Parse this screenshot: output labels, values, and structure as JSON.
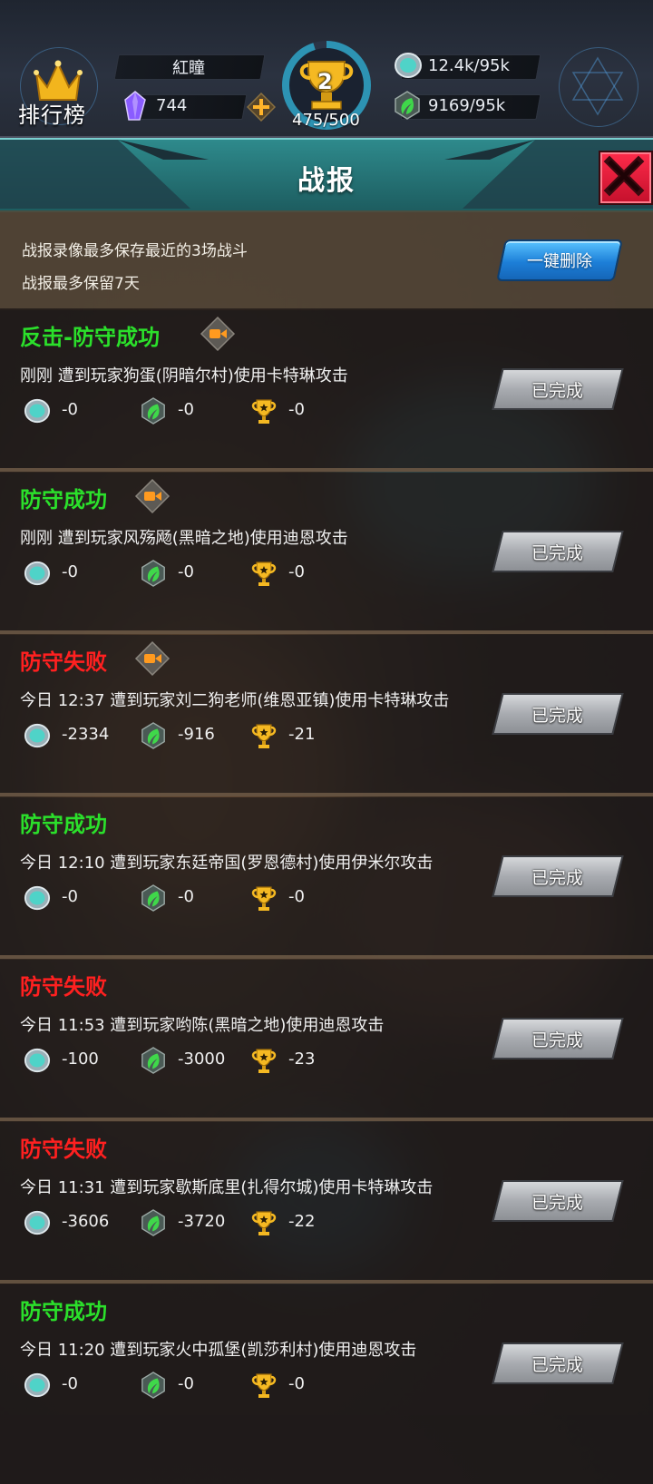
{
  "header": {
    "rank_label": "排行榜",
    "player_name": "紅瞳",
    "gems": "744",
    "trophy_level": "2",
    "trophy_progress": "475/500",
    "trophy_progress_fraction": 0.95,
    "stone": "12.4k/95k",
    "leaf": "9169/95k"
  },
  "title": "战报",
  "info": {
    "line1": "战报录像最多保存最近的3场战斗",
    "line2": "战报最多保留7天",
    "delete_all": "一键删除"
  },
  "reports": [
    {
      "result": "反击-防守成功",
      "status": "win",
      "video": true,
      "desc": "刚刚 遭到玩家狗蛋(阴暗尔村)使用卡特琳攻击",
      "stone": "-0",
      "leaf": "-0",
      "trophy": "-0",
      "button": "已完成"
    },
    {
      "result": "防守成功",
      "status": "win",
      "video": true,
      "desc": "刚刚 遭到玩家风殇飏(黑暗之地)使用迪恩攻击",
      "stone": "-0",
      "leaf": "-0",
      "trophy": "-0",
      "button": "已完成"
    },
    {
      "result": "防守失败",
      "status": "lose",
      "video": true,
      "desc": "今日 12:37 遭到玩家刘二狗老师(维恩亚镇)使用卡特琳攻击",
      "stone": "-2334",
      "leaf": "-916",
      "trophy": "-21",
      "button": "已完成"
    },
    {
      "result": "防守成功",
      "status": "win",
      "video": false,
      "desc": "今日 12:10 遭到玩家东廷帝国(罗恩德村)使用伊米尔攻击",
      "stone": "-0",
      "leaf": "-0",
      "trophy": "-0",
      "button": "已完成"
    },
    {
      "result": "防守失败",
      "status": "lose",
      "video": false,
      "desc": "今日 11:53 遭到玩家哟陈(黑暗之地)使用迪恩攻击",
      "stone": "-100",
      "leaf": "-3000",
      "trophy": "-23",
      "button": "已完成"
    },
    {
      "result": "防守失败",
      "status": "lose",
      "video": false,
      "desc": "今日 11:31 遭到玩家歇斯底里(扎得尔城)使用卡特琳攻击",
      "stone": "-3606",
      "leaf": "-3720",
      "trophy": "-22",
      "button": "已完成"
    },
    {
      "result": "防守成功",
      "status": "win",
      "video": false,
      "desc": "今日 11:20 遭到玩家火中孤堡(凯莎利村)使用迪恩攻击",
      "stone": "-0",
      "leaf": "-0",
      "trophy": "-0",
      "button": "已完成"
    }
  ],
  "colors": {
    "win": "#2be02b",
    "lose": "#ff2020",
    "title_bar": "#2e8a8c",
    "close_button": "#e01838",
    "delete_button": "#1d7fd8"
  }
}
